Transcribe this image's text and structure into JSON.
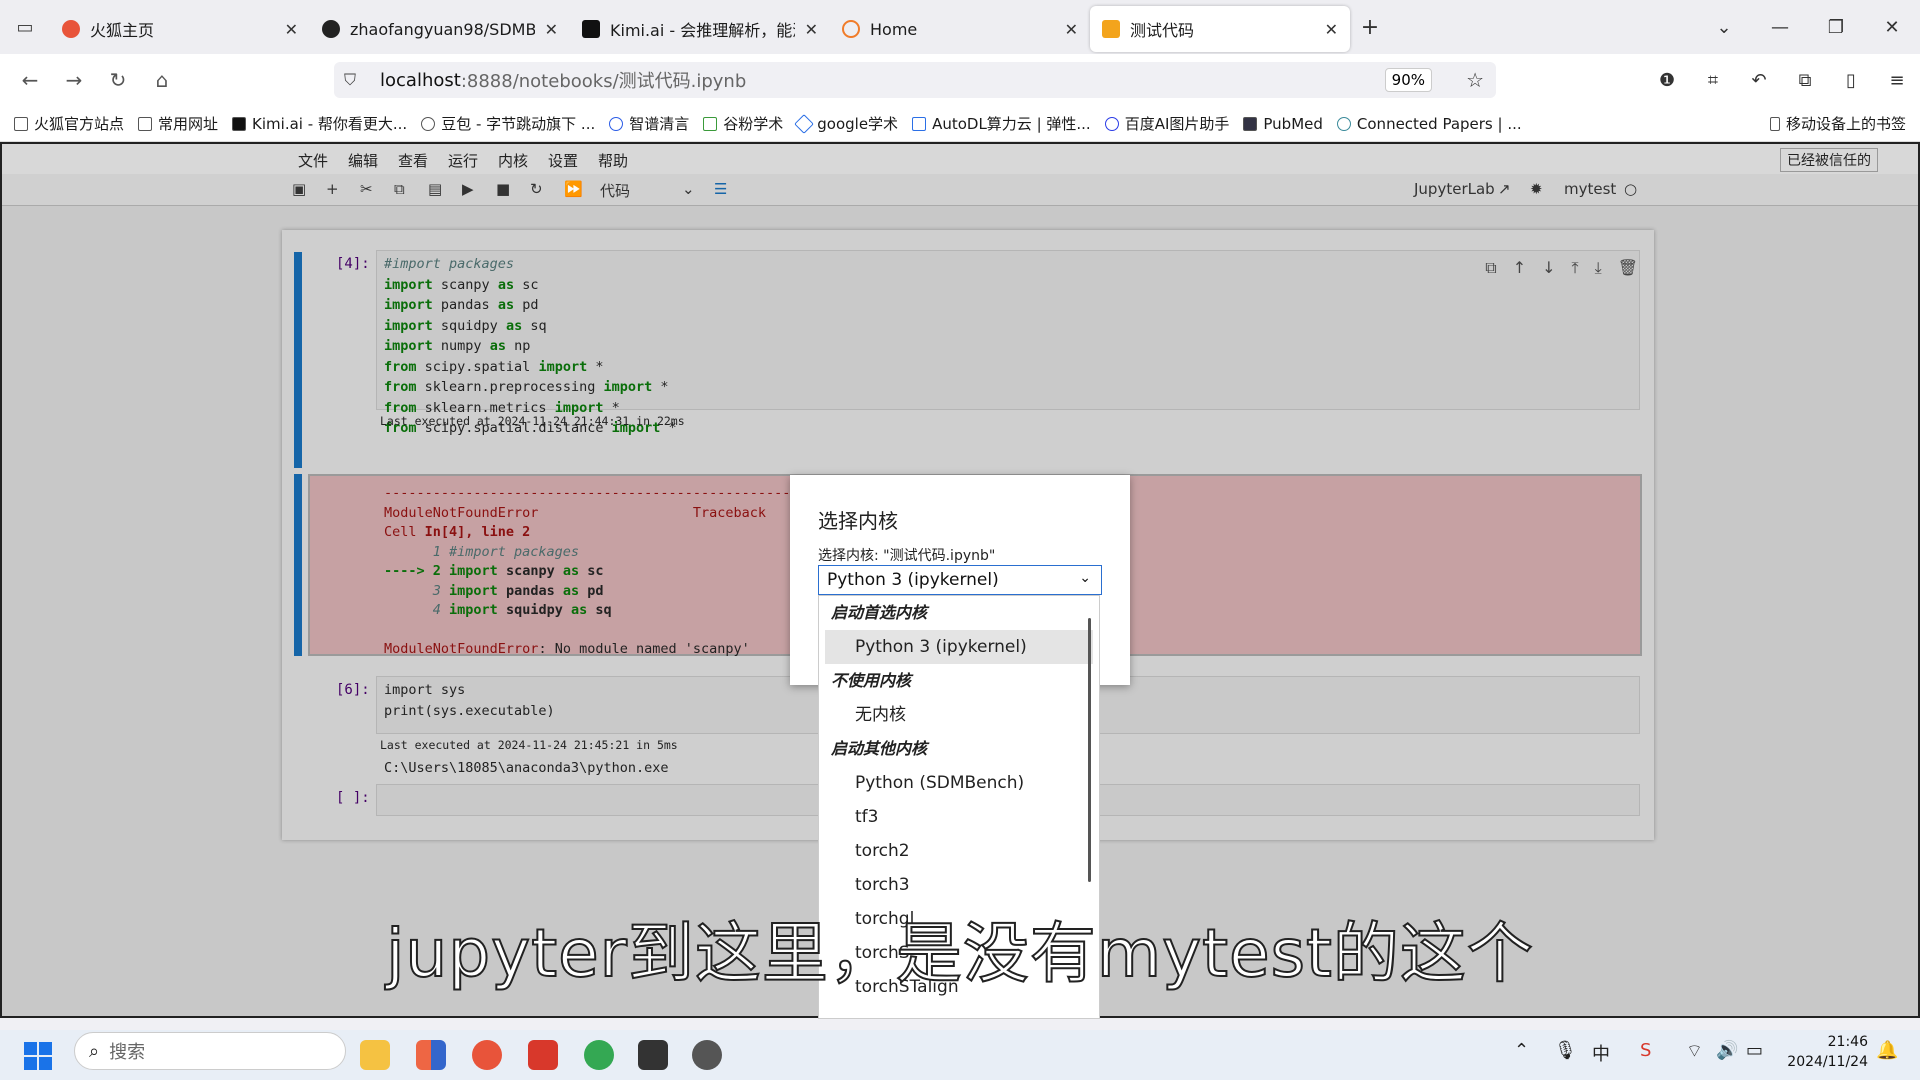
{
  "browser": {
    "tabs": [
      {
        "title": "火狐主页",
        "color": "#e8543a"
      },
      {
        "title": "zhaofangyuan98/SDMBench",
        "color": "#222222"
      },
      {
        "title": "Kimi.ai - 会推理解析，能深度思",
        "color": "#111111"
      },
      {
        "title": "Home",
        "color": "#f07c2a"
      },
      {
        "title": "测试代码",
        "color": "#f3a41c"
      }
    ],
    "url_host": "localhost",
    "url_path": ":8888/notebooks/测试代码.ipynb",
    "zoom": "90%",
    "bookmarks": [
      "火狐官方站点",
      "常用网址",
      "Kimi.ai - 帮你看更大...",
      "豆包 - 字节跳动旗下 ...",
      "智谱清言",
      "谷粉学术",
      "google学术",
      "AutoDL算力云 | 弹性...",
      "百度AI图片助手",
      "PubMed",
      "Connected Papers | ..."
    ],
    "bookmarks_right": "移动设备上的书签"
  },
  "jupyter": {
    "menu": [
      "文件",
      "编辑",
      "查看",
      "运行",
      "内核",
      "设置",
      "帮助"
    ],
    "trusted": "已经被信任的",
    "celltype": "代码",
    "jupyterlab": "JupyterLab",
    "kernel_name": "mytest",
    "cell1": {
      "prompt": "[4]:",
      "exec_info": "Last executed at 2024-11-24 21:44:31 in 22ms"
    },
    "error": {
      "dashes": "---------------------------------------------------------------------------",
      "name": "ModuleNotFoundError",
      "traceback": "Traceback",
      "loc1": "Cell ",
      "loc2": "In[4], line 2",
      "l1": "      1 #import packages",
      "l2arrow": "----> 2 ",
      "l3": "      3 ",
      "l4": "      4 ",
      "msg": ": No module named 'scanpy'"
    },
    "cell2": {
      "prompt": "[6]:",
      "line1": "import sys",
      "line2": "print(sys.executable)",
      "exec_info": "Last executed at 2024-11-24 21:45:21 in 5ms",
      "output": "C:\\Users\\18085\\anaconda3\\python.exe"
    },
    "cell3": {
      "prompt": "[ ]:"
    }
  },
  "dialog": {
    "title": "选择内核",
    "label": "选择内核:  \"测试代码.ipynb\"",
    "selected": "Python 3 (ipykernel)",
    "groups": [
      {
        "label": "启动首选内核",
        "options": [
          "Python 3 (ipykernel)"
        ]
      },
      {
        "label": "不使用内核",
        "options": [
          "无内核"
        ]
      },
      {
        "label": "启动其他内核",
        "options": [
          "Python (SDMBench)",
          "tf3",
          "torch2",
          "torch3",
          "torchgl",
          "torchS",
          "torchSTalign"
        ]
      }
    ]
  },
  "subtitle": "jupyter到这里，是没有mytest的这个",
  "taskbar": {
    "search": "搜索",
    "ime": "中",
    "time": "21:46",
    "date": "2024/11/24"
  }
}
